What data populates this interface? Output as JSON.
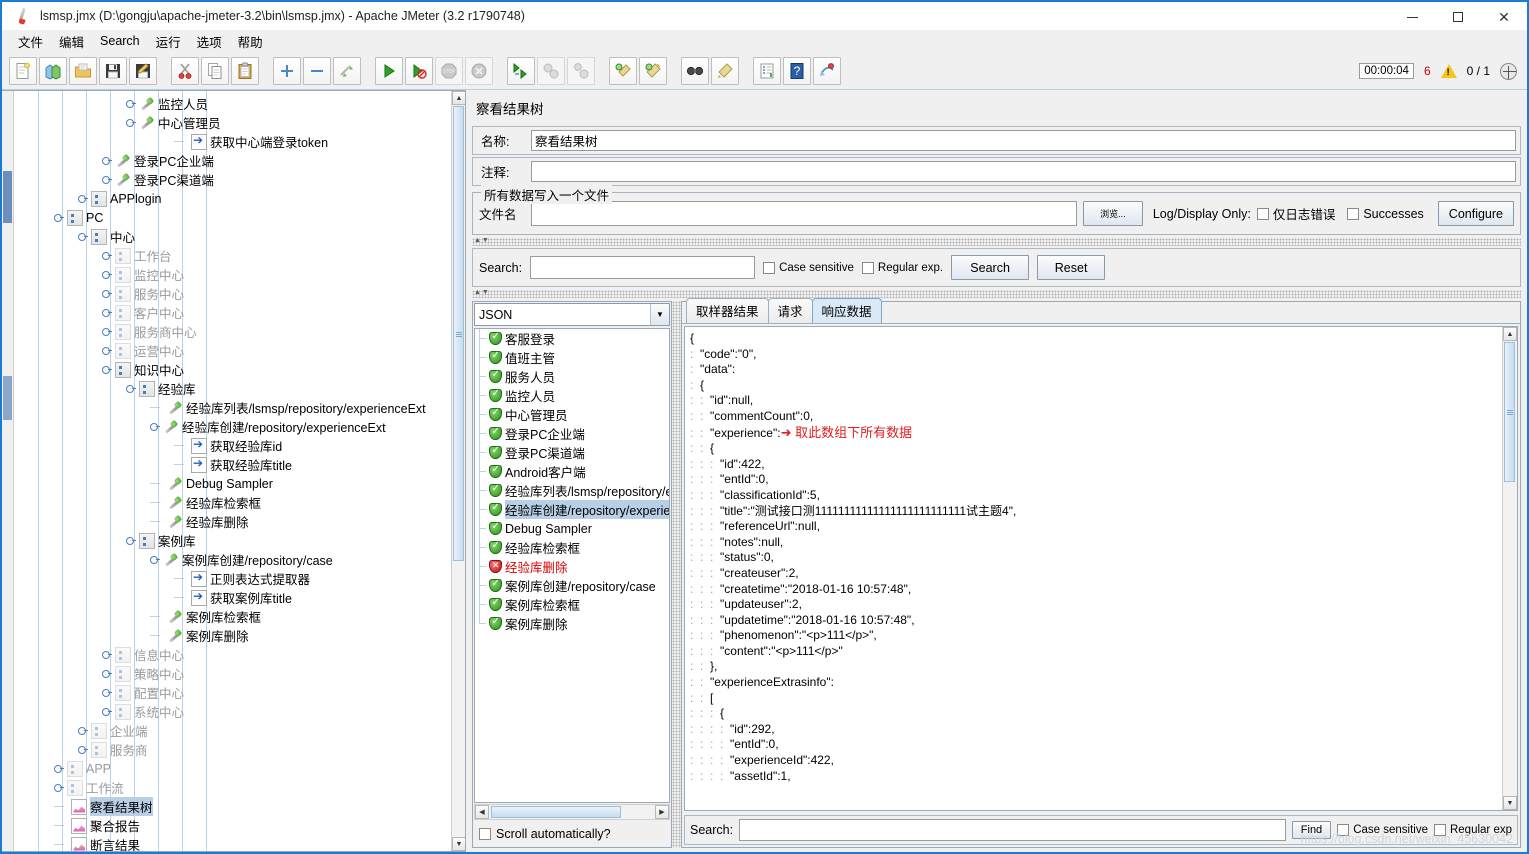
{
  "window": {
    "title": "lsmsp.jmx (D:\\gongju\\apache-jmeter-3.2\\bin\\lsmsp.jmx) - Apache JMeter (3.2 r1790748)",
    "minimize_label": "—",
    "maximize_label": "□",
    "close_label": "✕"
  },
  "menu": {
    "items": [
      {
        "label": "文件",
        "name": "menu-file"
      },
      {
        "label": "编辑",
        "name": "menu-edit"
      },
      {
        "label": "Search",
        "name": "menu-search"
      },
      {
        "label": "运行",
        "name": "menu-run"
      },
      {
        "label": "选项",
        "name": "menu-options"
      },
      {
        "label": "帮助",
        "name": "menu-help"
      }
    ]
  },
  "toolbar": {
    "buttons": [
      {
        "name": "new-icon",
        "title": "New"
      },
      {
        "name": "templates-icon",
        "title": "Templates"
      },
      {
        "name": "open-icon",
        "title": "Open"
      },
      {
        "name": "save-icon",
        "title": "Save"
      },
      {
        "name": "save-as-icon",
        "title": "Save as"
      },
      {
        "name": "cut-icon",
        "title": "Cut"
      },
      {
        "name": "copy-icon",
        "title": "Copy"
      },
      {
        "name": "paste-icon",
        "title": "Paste"
      },
      {
        "name": "expand-icon",
        "title": "Expand all"
      },
      {
        "name": "collapse-icon",
        "title": "Collapse all"
      },
      {
        "name": "toggle-icon",
        "title": "Toggle"
      },
      {
        "name": "start-icon",
        "title": "Start"
      },
      {
        "name": "start-no-pauses-icon",
        "title": "Start no pauses"
      },
      {
        "name": "stop-icon",
        "title": "Stop"
      },
      {
        "name": "shutdown-icon",
        "title": "Shutdown"
      },
      {
        "name": "remote-start-all-icon",
        "title": "Remote start all"
      },
      {
        "name": "remote-stop-all-icon",
        "title": "Remote stop all"
      },
      {
        "name": "remote-shutdown-all-icon",
        "title": "Remote shutdown all"
      },
      {
        "name": "clear-icon",
        "title": "Clear"
      },
      {
        "name": "clear-all-icon",
        "title": "Clear all"
      },
      {
        "name": "search-icon",
        "title": "Search"
      },
      {
        "name": "search-reset-icon",
        "title": "Reset search"
      },
      {
        "name": "function-helper-icon",
        "title": "Function helper"
      },
      {
        "name": "help-icon",
        "title": "Help"
      },
      {
        "name": "undo-icon",
        "title": "Undo"
      }
    ],
    "timer": "00:00:04",
    "warning_count": "6",
    "thread_count": "0 / 1"
  },
  "tree": {
    "nodes": [
      {
        "label": "监控人员",
        "indent": 5,
        "icon": "sampler",
        "dim": false,
        "handle": true,
        "sel": false
      },
      {
        "label": "中心管理员",
        "indent": 5,
        "icon": "sampler",
        "dim": false,
        "handle": true,
        "sel": false
      },
      {
        "label": "获取中心端登录token",
        "indent": 7,
        "icon": "post",
        "dim": false,
        "handle": false,
        "sel": false
      },
      {
        "label": "登录PC企业端",
        "indent": 4,
        "icon": "sampler",
        "dim": false,
        "handle": true,
        "sel": false
      },
      {
        "label": "登录PC渠道端",
        "indent": 4,
        "icon": "sampler",
        "dim": false,
        "handle": true,
        "sel": false
      },
      {
        "label": "APPlogin",
        "indent": 3,
        "icon": "controller",
        "dim": false,
        "handle": true,
        "sel": false
      },
      {
        "label": "PC",
        "indent": 2,
        "icon": "controller",
        "dim": false,
        "handle": true,
        "sel": false
      },
      {
        "label": "中心",
        "indent": 3,
        "icon": "controller",
        "dim": false,
        "handle": true,
        "sel": false
      },
      {
        "label": "工作台",
        "indent": 4,
        "icon": "controller",
        "dim": true,
        "handle": true,
        "sel": false
      },
      {
        "label": "监控中心",
        "indent": 4,
        "icon": "controller",
        "dim": true,
        "handle": true,
        "sel": false
      },
      {
        "label": "服务中心",
        "indent": 4,
        "icon": "controller",
        "dim": true,
        "handle": true,
        "sel": false
      },
      {
        "label": "客户中心",
        "indent": 4,
        "icon": "controller",
        "dim": true,
        "handle": true,
        "sel": false
      },
      {
        "label": "服务商中心",
        "indent": 4,
        "icon": "controller",
        "dim": true,
        "handle": true,
        "sel": false
      },
      {
        "label": "运营中心",
        "indent": 4,
        "icon": "controller",
        "dim": true,
        "handle": true,
        "sel": false
      },
      {
        "label": "知识中心",
        "indent": 4,
        "icon": "controller",
        "dim": false,
        "handle": true,
        "sel": false
      },
      {
        "label": "经验库",
        "indent": 5,
        "icon": "controller",
        "dim": false,
        "handle": true,
        "sel": false
      },
      {
        "label": "经验库列表/lsmsp/repository/experienceExt",
        "indent": 6,
        "icon": "sampler",
        "dim": false,
        "handle": false,
        "sel": false
      },
      {
        "label": "经验库创建/repository/experienceExt",
        "indent": 6,
        "icon": "sampler",
        "dim": false,
        "handle": true,
        "sel": false
      },
      {
        "label": "获取经验库id",
        "indent": 7,
        "icon": "post",
        "dim": false,
        "handle": false,
        "sel": false
      },
      {
        "label": "获取经验库title",
        "indent": 7,
        "icon": "post",
        "dim": false,
        "handle": false,
        "sel": false
      },
      {
        "label": "Debug Sampler",
        "indent": 6,
        "icon": "sampler",
        "dim": false,
        "handle": false,
        "sel": false
      },
      {
        "label": "经验库检索框",
        "indent": 6,
        "icon": "sampler",
        "dim": false,
        "handle": false,
        "sel": false
      },
      {
        "label": "经验库删除",
        "indent": 6,
        "icon": "sampler",
        "dim": false,
        "handle": false,
        "sel": false
      },
      {
        "label": "案例库",
        "indent": 5,
        "icon": "controller",
        "dim": false,
        "handle": true,
        "sel": false
      },
      {
        "label": "案例库创建/repository/case",
        "indent": 6,
        "icon": "sampler",
        "dim": false,
        "handle": true,
        "sel": false
      },
      {
        "label": "正则表达式提取器",
        "indent": 7,
        "icon": "post",
        "dim": false,
        "handle": false,
        "sel": false
      },
      {
        "label": "获取案例库title",
        "indent": 7,
        "icon": "post",
        "dim": false,
        "handle": false,
        "sel": false
      },
      {
        "label": "案例库检索框",
        "indent": 6,
        "icon": "sampler",
        "dim": false,
        "handle": false,
        "sel": false
      },
      {
        "label": "案例库删除",
        "indent": 6,
        "icon": "sampler",
        "dim": false,
        "handle": false,
        "sel": false
      },
      {
        "label": "信息中心",
        "indent": 4,
        "icon": "controller",
        "dim": true,
        "handle": true,
        "sel": false
      },
      {
        "label": "策略中心",
        "indent": 4,
        "icon": "controller",
        "dim": true,
        "handle": true,
        "sel": false
      },
      {
        "label": "配置中心",
        "indent": 4,
        "icon": "controller",
        "dim": true,
        "handle": true,
        "sel": false
      },
      {
        "label": "系统中心",
        "indent": 4,
        "icon": "controller",
        "dim": true,
        "handle": true,
        "sel": false
      },
      {
        "label": "企业端",
        "indent": 3,
        "icon": "controller",
        "dim": true,
        "handle": true,
        "sel": false
      },
      {
        "label": "服务商",
        "indent": 3,
        "icon": "controller",
        "dim": true,
        "handle": true,
        "sel": false
      },
      {
        "label": "APP",
        "indent": 2,
        "icon": "controller",
        "dim": true,
        "handle": true,
        "sel": false
      },
      {
        "label": "工作流",
        "indent": 2,
        "icon": "controller",
        "dim": true,
        "handle": true,
        "sel": false
      },
      {
        "label": "察看结果树",
        "indent": 2,
        "icon": "listener",
        "dim": false,
        "handle": false,
        "sel": true
      },
      {
        "label": "聚合报告",
        "indent": 2,
        "icon": "listener",
        "dim": false,
        "handle": false,
        "sel": false
      },
      {
        "label": "断言结果",
        "indent": 2,
        "icon": "listener",
        "dim": false,
        "handle": false,
        "sel": false
      }
    ]
  },
  "panel": {
    "title": "察看结果树",
    "name_label": "名称:",
    "name_value": "察看结果树",
    "comment_label": "注释:",
    "comment_value": "",
    "filegroup": {
      "title": "所有数据写入一个文件",
      "filename_label": "文件名",
      "filename_value": "",
      "browse_label": "浏览...",
      "logdisplay_label": "Log/Display Only:",
      "errors_only_label": "仅日志错误",
      "successes_label": "Successes",
      "configure_label": "Configure"
    },
    "search": {
      "label": "Search:",
      "value": "",
      "case_sensitive_label": "Case sensitive",
      "regular_exp_label": "Regular exp.",
      "search_button": "Search",
      "reset_button": "Reset"
    }
  },
  "results": {
    "renderer_selected": "JSON",
    "scroll_auto_label": "Scroll automatically?",
    "items": [
      {
        "label": "客服登录",
        "status": "ok",
        "selected": false
      },
      {
        "label": "值班主管",
        "status": "ok",
        "selected": false
      },
      {
        "label": "服务人员",
        "status": "ok",
        "selected": false
      },
      {
        "label": "监控人员",
        "status": "ok",
        "selected": false
      },
      {
        "label": "中心管理员",
        "status": "ok",
        "selected": false
      },
      {
        "label": "登录PC企业端",
        "status": "ok",
        "selected": false
      },
      {
        "label": "登录PC渠道端",
        "status": "ok",
        "selected": false
      },
      {
        "label": "Android客户端",
        "status": "ok",
        "selected": false
      },
      {
        "label": "经验库列表/lsmsp/repository/experienceExt",
        "status": "ok",
        "selected": false
      },
      {
        "label": "经验库创建/repository/experienceExt",
        "status": "ok",
        "selected": true
      },
      {
        "label": "Debug Sampler",
        "status": "ok",
        "selected": false
      },
      {
        "label": "经验库检索框",
        "status": "ok",
        "selected": false
      },
      {
        "label": "经验库删除",
        "status": "error",
        "selected": false
      },
      {
        "label": "案例库创建/repository/case",
        "status": "ok",
        "selected": false
      },
      {
        "label": "案例库检索框",
        "status": "ok",
        "selected": false
      },
      {
        "label": "案例库删除",
        "status": "ok",
        "selected": false
      }
    ]
  },
  "viewer": {
    "tabs": [
      {
        "label": "取样器结果",
        "active": false
      },
      {
        "label": "请求",
        "active": false
      },
      {
        "label": "响应数据",
        "active": true
      }
    ],
    "annotation": "取此数组下所有数据",
    "lines": [
      "{",
      ":  \"code\":\"0\",",
      ":  \"data\":",
      ":  {",
      ":  :  \"id\":null,",
      ":  :  \"commentCount\":0,",
      ":  :  \"experience\":",
      ":  :  {",
      ":  :  :  \"id\":422,",
      ":  :  :  \"entId\":0,",
      ":  :  :  \"classificationId\":5,",
      ":  :  :  \"title\":\"测试接口测11111111111111111111111111试主题4\",",
      ":  :  :  \"referenceUrl\":null,",
      ":  :  :  \"notes\":null,",
      ":  :  :  \"status\":0,",
      ":  :  :  \"createuser\":2,",
      ":  :  :  \"createtime\":\"2018-01-16 10:57:48\",",
      ":  :  :  \"updateuser\":2,",
      ":  :  :  \"updatetime\":\"2018-01-16 10:57:48\",",
      ":  :  :  \"phenomenon\":\"<p>111</p>\",",
      ":  :  :  \"content\":\"<p>111</p>\"",
      ":  :  },",
      ":  :  \"experienceExtrasinfo\":",
      ":  :  [",
      ":  :  :  {",
      ":  :  :  :  \"id\":292,",
      ":  :  :  :  \"entId\":0,",
      ":  :  :  :  \"experienceId\":422,",
      ":  :  :  :  \"assetId\":1,"
    ]
  },
  "bottom_search": {
    "label": "Search:",
    "value": "",
    "find_button": "Find",
    "case_sensitive_label": "Case sensitive",
    "regular_exp_label": "Regular exp"
  },
  "watermark": "https://blog.csdn.net/weixin_45630042"
}
